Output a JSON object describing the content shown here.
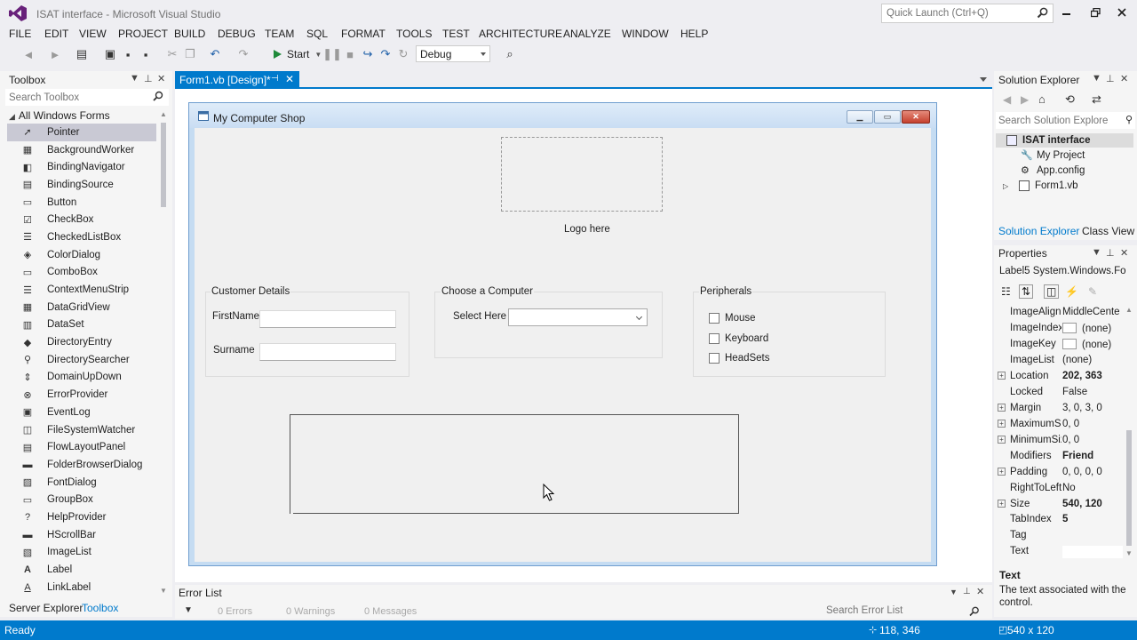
{
  "window": {
    "title": "ISAT interface - Microsoft Visual Studio",
    "quick_launch_placeholder": "Quick Launch (Ctrl+Q)"
  },
  "menu": [
    "FILE",
    "EDIT",
    "VIEW",
    "PROJECT",
    "BUILD",
    "DEBUG",
    "TEAM",
    "SQL",
    "FORMAT",
    "TOOLS",
    "TEST",
    "ARCHITECTURE",
    "ANALYZE",
    "WINDOW",
    "HELP"
  ],
  "toolbar": {
    "start_label": "Start",
    "config_value": "Debug"
  },
  "toolbox": {
    "title": "Toolbox",
    "search_placeholder": "Search Toolbox",
    "group": "All Windows Forms",
    "items": [
      "Pointer",
      "BackgroundWorker",
      "BindingNavigator",
      "BindingSource",
      "Button",
      "CheckBox",
      "CheckedListBox",
      "ColorDialog",
      "ComboBox",
      "ContextMenuStrip",
      "DataGridView",
      "DataSet",
      "DirectoryEntry",
      "DirectorySearcher",
      "DomainUpDown",
      "ErrorProvider",
      "EventLog",
      "FileSystemWatcher",
      "FlowLayoutPanel",
      "FolderBrowserDialog",
      "FontDialog",
      "GroupBox",
      "HelpProvider",
      "HScrollBar",
      "ImageList",
      "Label",
      "LinkLabel"
    ],
    "bottom_tabs": [
      "Server Explorer",
      "Toolbox"
    ]
  },
  "document": {
    "tab_label": "Form1.vb [Design]*"
  },
  "form": {
    "title": "My Computer Shop",
    "logo_label": "Logo here",
    "customer_group": "Customer Details",
    "firstname_label": "FirstName",
    "surname_label": "Surname",
    "computer_group": "Choose a Computer",
    "select_label": "Select Here",
    "peripherals_group": "Peripherals",
    "peripherals": [
      "Mouse",
      "Keyboard",
      "HeadSets"
    ]
  },
  "error_list": {
    "title": "Error List",
    "errors": "0 Errors",
    "warnings": "0 Warnings",
    "messages": "0 Messages",
    "search_placeholder": "Search Error List"
  },
  "solution_explorer": {
    "title": "Solution Explorer",
    "search_placeholder": "Search Solution Explore",
    "tree": [
      "ISAT interface",
      "My Project",
      "App.config",
      "Form1.vb"
    ],
    "tabs": [
      "Solution Explorer",
      "Class View"
    ]
  },
  "properties": {
    "title": "Properties",
    "object": "Label5  System.Windows.Fo",
    "rows": [
      {
        "name": "ImageAlign",
        "value": "MiddleCente"
      },
      {
        "name": "ImageIndex",
        "value": "(none)"
      },
      {
        "name": "ImageKey",
        "value": "(none)"
      },
      {
        "name": "ImageList",
        "value": "(none)"
      },
      {
        "name": "Location",
        "value": "202, 363"
      },
      {
        "name": "Locked",
        "value": "False"
      },
      {
        "name": "Margin",
        "value": "3, 0, 3, 0"
      },
      {
        "name": "MaximumSize",
        "value": "0, 0"
      },
      {
        "name": "MinimumSize",
        "value": "0, 0"
      },
      {
        "name": "Modifiers",
        "value": "Friend"
      },
      {
        "name": "Padding",
        "value": "0, 0, 0, 0"
      },
      {
        "name": "RightToLeft",
        "value": "No"
      },
      {
        "name": "Size",
        "value": "540, 120"
      },
      {
        "name": "TabIndex",
        "value": "5"
      },
      {
        "name": "Tag",
        "value": ""
      },
      {
        "name": "Text",
        "value": ""
      }
    ],
    "desc_title": "Text",
    "desc_text": "The text associated with the control."
  },
  "status": {
    "text": "Ready",
    "position": "118, 346",
    "size": "540 x 120"
  },
  "colors": {
    "accent": "#007acc",
    "chrome": "#eeeef2"
  }
}
